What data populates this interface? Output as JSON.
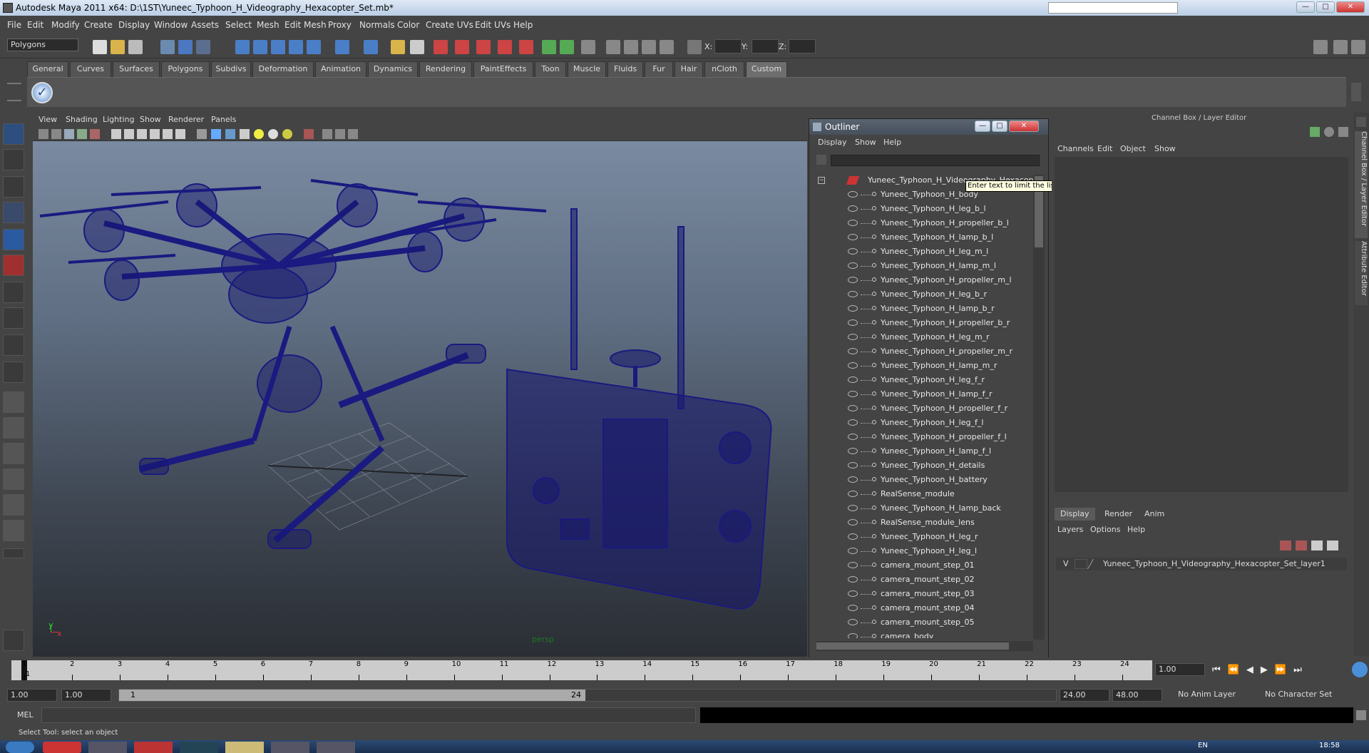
{
  "window": {
    "title": "Autodesk Maya 2011 x64: D:\\1ST\\Yuneec_Typhoon_H_Videography_Hexacopter_Set.mb*",
    "search_placeholder": "",
    "controls": {
      "minimize": "—",
      "maximize": "□",
      "close": "✕"
    }
  },
  "menubar": [
    "File",
    "Edit",
    "Modify",
    "Create",
    "Display",
    "Window",
    "Assets",
    "Select",
    "Mesh",
    "Edit Mesh",
    "Proxy",
    "Normals",
    "Color",
    "Create UVs",
    "Edit UVs",
    "Help"
  ],
  "mode_selector": {
    "value": "Polygons"
  },
  "coords": {
    "x_label": "X:",
    "y_label": "Y:",
    "z_label": "Z:"
  },
  "shelf_tabs": [
    "General",
    "Curves",
    "Surfaces",
    "Polygons",
    "Subdivs",
    "Deformation",
    "Animation",
    "Dynamics",
    "Rendering",
    "PaintEffects",
    "Toon",
    "Muscle",
    "Fluids",
    "Fur",
    "Hair",
    "nCloth",
    "Custom"
  ],
  "shelf_active": "Custom",
  "viewport": {
    "menu": [
      "View",
      "Shading",
      "Lighting",
      "Show",
      "Renderer",
      "Panels"
    ],
    "camera_label": "persp",
    "axis_y": "y",
    "axis_x": "x",
    "wire_color": "#1a1a80"
  },
  "outliner": {
    "title": "Outliner",
    "menu": [
      "Display",
      "Show",
      "Help"
    ],
    "tooltip": "Enter text to limit the list",
    "root": "Yuneec_Typhoon_H_Videography_Hexacopter_Set",
    "items": [
      "Yuneec_Typhoon_H_body",
      "Yuneec_Typhoon_H_leg_b_l",
      "Yuneec_Typhoon_H_propeller_b_l",
      "Yuneec_Typhoon_H_lamp_b_l",
      "Yuneec_Typhoon_H_leg_m_l",
      "Yuneec_Typhoon_H_lamp_m_l",
      "Yuneec_Typhoon_H_propeller_m_l",
      "Yuneec_Typhoon_H_leg_b_r",
      "Yuneec_Typhoon_H_lamp_b_r",
      "Yuneec_Typhoon_H_propeller_b_r",
      "Yuneec_Typhoon_H_leg_m_r",
      "Yuneec_Typhoon_H_propeller_m_r",
      "Yuneec_Typhoon_H_lamp_m_r",
      "Yuneec_Typhoon_H_leg_f_r",
      "Yuneec_Typhoon_H_lamp_f_r",
      "Yuneec_Typhoon_H_propeller_f_r",
      "Yuneec_Typhoon_H_leg_f_l",
      "Yuneec_Typhoon_H_propeller_f_l",
      "Yuneec_Typhoon_H_lamp_f_l",
      "Yuneec_Typhoon_H_details",
      "Yuneec_Typhoon_H_battery",
      "RealSense_module",
      "Yuneec_Typhoon_H_lamp_back",
      "RealSense_module_lens",
      "Yuneec_Typhoon_H_leg_r",
      "Yuneec_Typhoon_H_leg_l",
      "camera_mount_step_01",
      "camera_mount_step_02",
      "camera_mount_step_03",
      "camera_mount_step_04",
      "camera_mount_step_05",
      "camera_body"
    ]
  },
  "channel_box": {
    "title": "Channel Box / Layer Editor",
    "menu": [
      "Channels",
      "Edit",
      "Object",
      "Show"
    ]
  },
  "layer_editor": {
    "tabs": [
      "Display",
      "Render",
      "Anim"
    ],
    "active_tab": "Display",
    "menu": [
      "Layers",
      "Options",
      "Help"
    ],
    "layer_visible": "V",
    "layer_name": "Yuneec_Typhoon_H_Videography_Hexacopter_Set_layer1"
  },
  "side_tabs": [
    "Channel Box / Layer Editor",
    "Attribute Editor"
  ],
  "timeline": {
    "ticks": [
      "1",
      "2",
      "3",
      "4",
      "5",
      "6",
      "7",
      "8",
      "9",
      "10",
      "11",
      "12",
      "13",
      "14",
      "15",
      "16",
      "17",
      "18",
      "19",
      "20",
      "21",
      "22",
      "23",
      "24"
    ],
    "current_frame_field": "1.00",
    "current_marker": "1"
  },
  "range": {
    "start": "1.00",
    "start_inner": "1.00",
    "slider_start": "1",
    "slider_end": "24",
    "end_inner": "24.00",
    "end": "48.00",
    "anim_layer": "No Anim Layer",
    "character_set": "No Character Set"
  },
  "command": {
    "label": "MEL"
  },
  "status": {
    "text": "Select Tool: select an object"
  },
  "taskbar": {
    "lang": "EN",
    "clock": "18:58"
  }
}
